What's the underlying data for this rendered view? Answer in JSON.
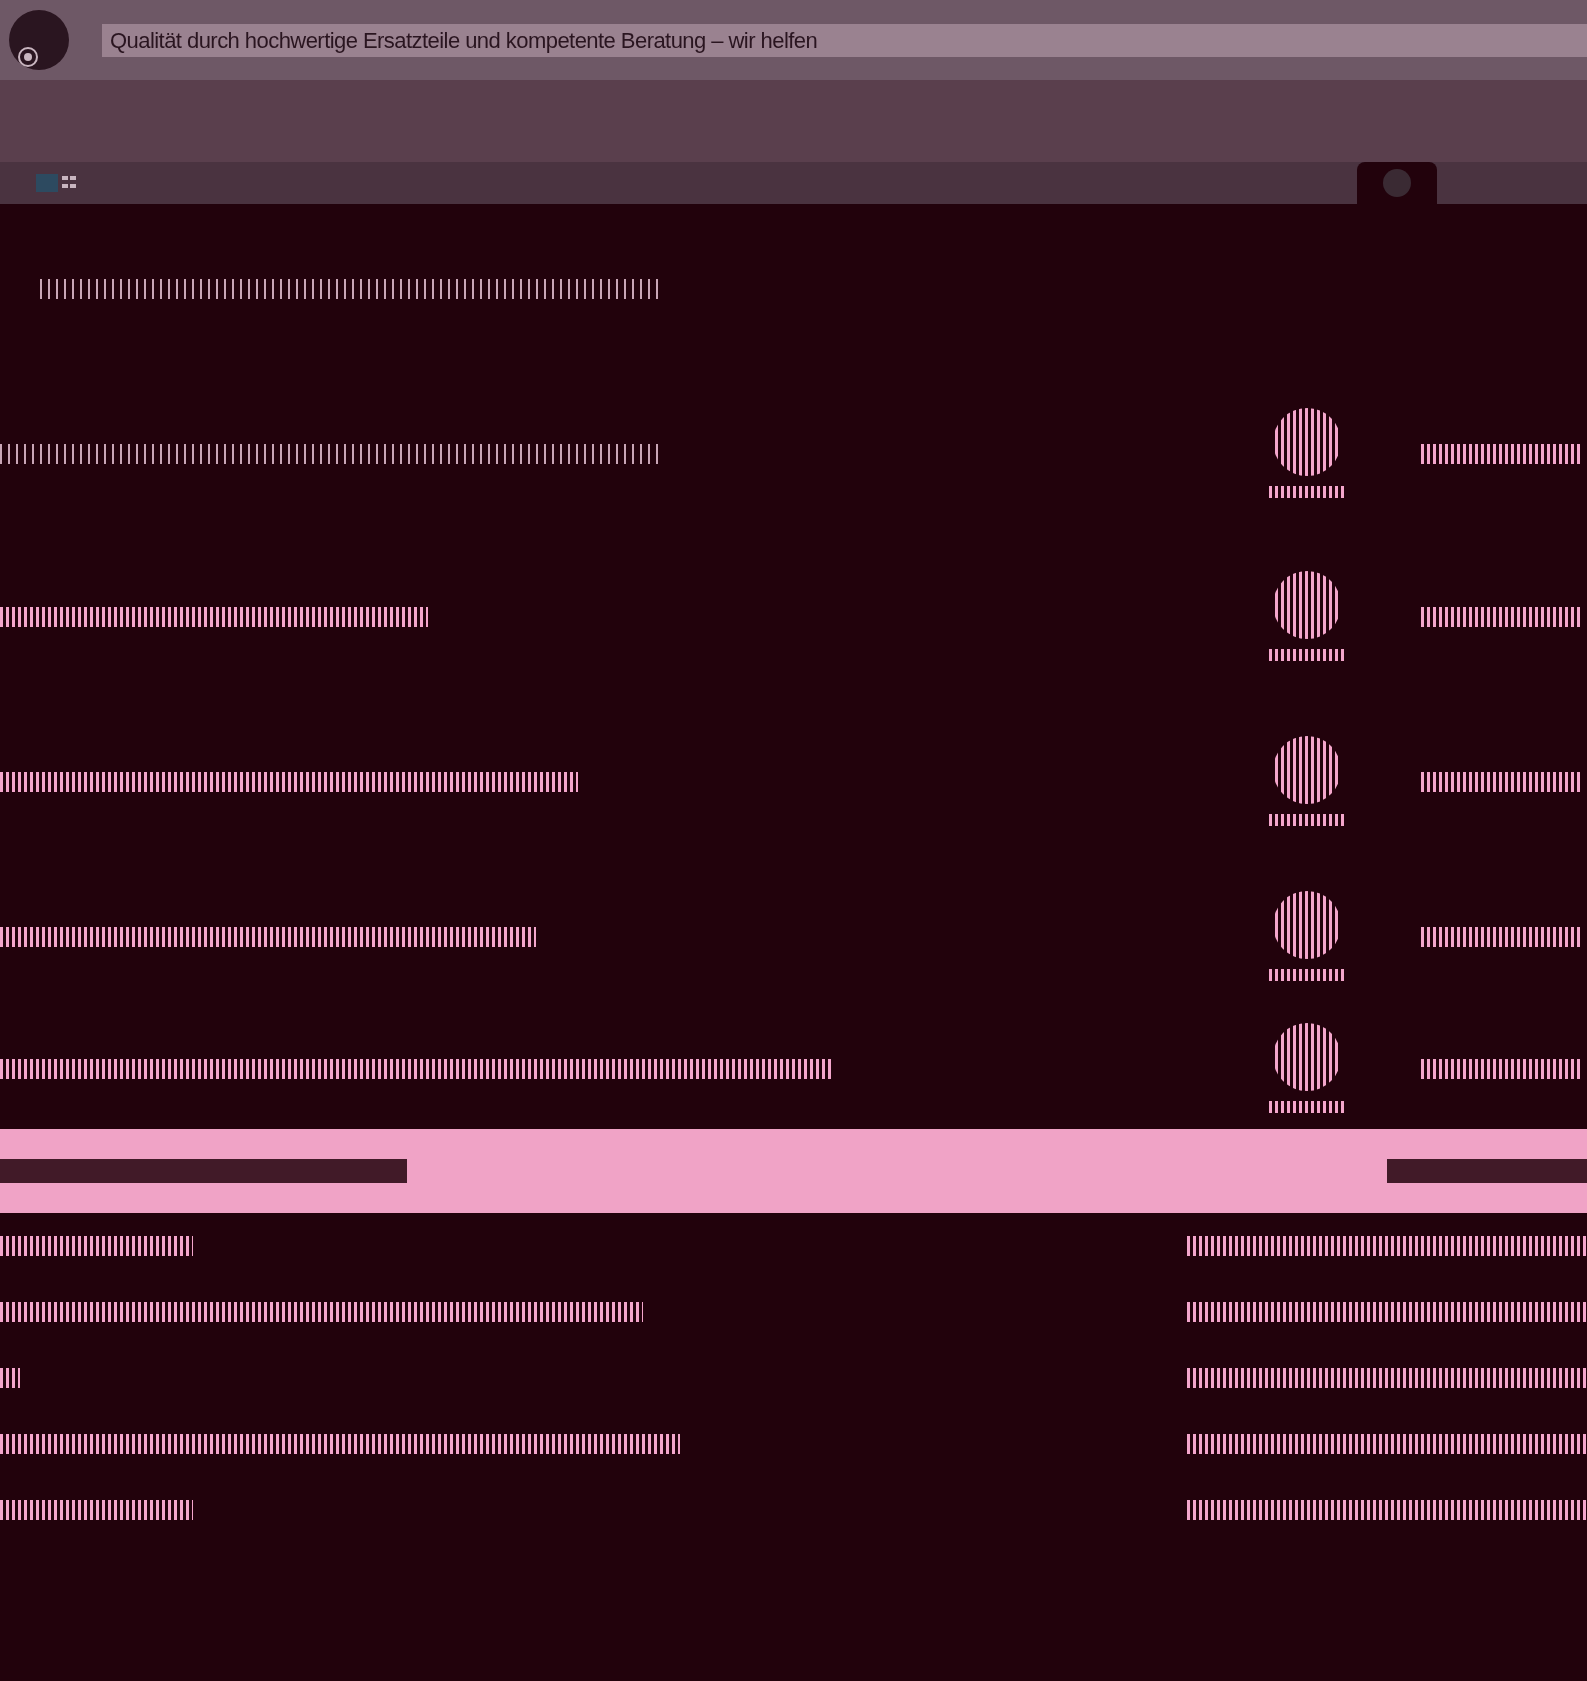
{
  "header": {
    "title": "Qualität durch hochwertige Ersatzteile und kompetente Beratung – wir helfen"
  }
}
